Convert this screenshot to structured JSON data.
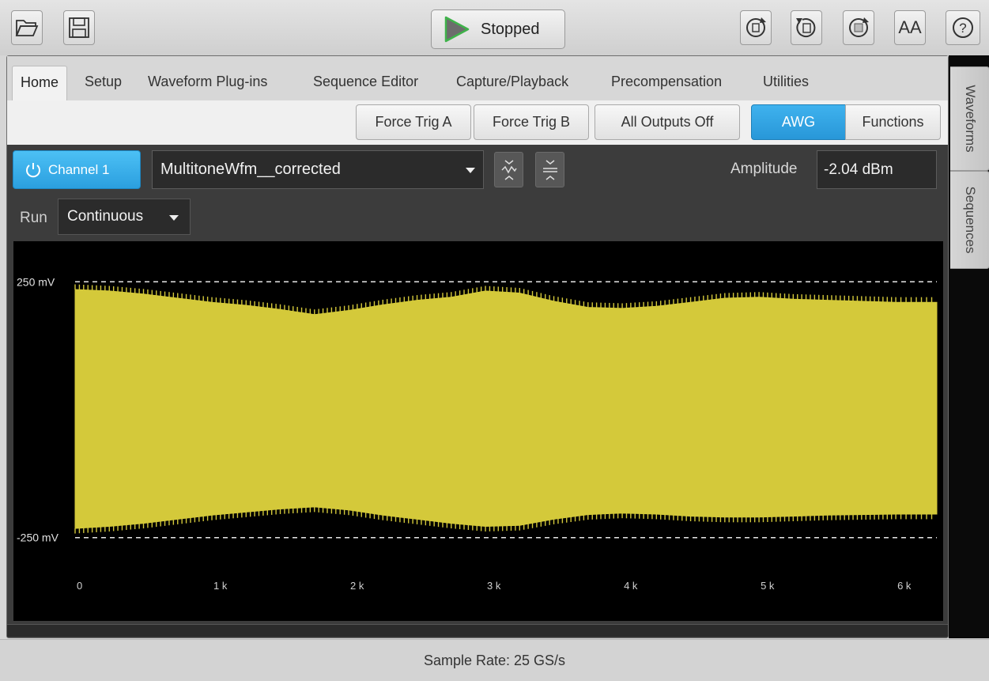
{
  "toolbar": {
    "open_icon": "folder-open-icon",
    "save_icon": "floppy-save-icon",
    "run_status": "Stopped",
    "run_icon": "play-icon",
    "right_icons": [
      "reset-icon",
      "recall-setup-icon",
      "restore-icon",
      "font-size-icon",
      "help-icon"
    ],
    "font_size_label": "AA",
    "help_label": "?"
  },
  "menu": {
    "tabs": [
      "Home",
      "Setup",
      "Waveform Plug-ins",
      "Sequence Editor",
      "Capture/Playback",
      "Precompensation",
      "Utilities"
    ],
    "active": "Home"
  },
  "modebar": {
    "force_trig_a": "Force Trig A",
    "force_trig_b": "Force Trig B",
    "all_outputs_off": "All Outputs Off",
    "awg": "AWG",
    "functions": "Functions"
  },
  "channel": {
    "label": "Channel 1",
    "waveform": "MultitoneWfm__corrected",
    "amplitude_label": "Amplitude",
    "amplitude_value": "-2.04 dBm"
  },
  "run": {
    "label": "Run",
    "mode": "Continuous"
  },
  "plot": {
    "y_top_label": "250 mV",
    "y_bottom_label": "-250 mV",
    "x_ticks": [
      "0",
      "1 k",
      "2 k",
      "3 k",
      "4 k",
      "5 k",
      "6 k"
    ]
  },
  "chart_data": {
    "type": "area",
    "x": [
      0,
      250,
      500,
      750,
      1000,
      1250,
      1500,
      1750,
      2000,
      2250,
      2500,
      2750,
      3000,
      3250,
      3500,
      3750,
      4000,
      4250,
      4500,
      4750,
      5000,
      5250,
      5500,
      5750,
      6000,
      6300
    ],
    "upper": [
      235,
      232,
      226,
      218,
      210,
      204,
      196,
      186,
      194,
      205,
      214,
      220,
      232,
      228,
      212,
      200,
      198,
      202,
      210,
      218,
      220,
      216,
      214,
      212,
      210,
      210
    ],
    "lower": [
      -232,
      -228,
      -222,
      -214,
      -206,
      -200,
      -194,
      -190,
      -196,
      -206,
      -214,
      -222,
      -228,
      -226,
      -214,
      -205,
      -202,
      -204,
      -208,
      -210,
      -210,
      -208,
      -206,
      -205,
      -204,
      -204
    ],
    "y_ticks": [
      "250 mV",
      "-250 mV"
    ],
    "x_tick_labels": [
      "0",
      "1 k",
      "2 k",
      "3 k",
      "4 k",
      "5 k",
      "6 k"
    ],
    "xlim": [
      0,
      6300
    ],
    "ylim": [
      -320,
      320
    ],
    "fill_color": "#d4c93a",
    "reference_lines": [
      250,
      -250
    ]
  },
  "side_tabs": [
    "Waveforms",
    "Sequences"
  ],
  "status": {
    "sample_rate": "Sample Rate: 25 GS/s"
  },
  "colors": {
    "accent": "#2b9fdf",
    "waveform": "#d4c93a",
    "play_green": "#3fb24a"
  }
}
